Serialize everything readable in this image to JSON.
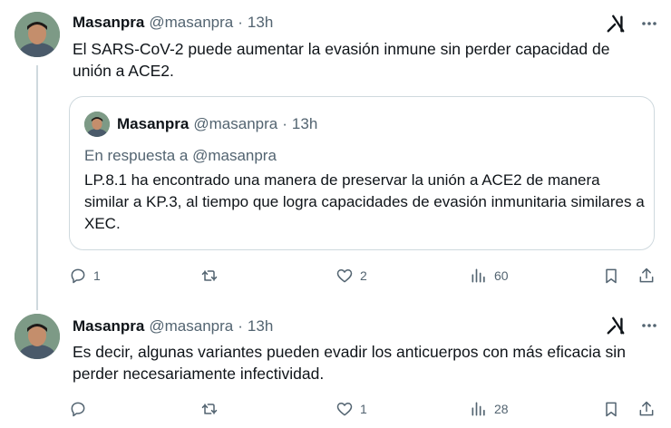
{
  "tweets": [
    {
      "author": {
        "name": "Masanpra",
        "handle": "@masanpra"
      },
      "time": "13h",
      "separator": "·",
      "text": "El SARS-CoV-2 puede aumentar la evasión inmune sin perder capacidad de unión a ACE2.",
      "quoted": {
        "author": {
          "name": "Masanpra",
          "handle": "@masanpra"
        },
        "time": "13h",
        "separator": "·",
        "reply_to": "En respuesta a @masanpra",
        "text": "LP.8.1 ha encontrado una manera de preservar la unión a ACE2 de manera similar a KP.3, al tiempo que logra capacidades de evasión inmunitaria similares a XEC."
      },
      "actions": {
        "replies": "1",
        "retweets": "",
        "likes": "2",
        "views": "60"
      }
    },
    {
      "author": {
        "name": "Masanpra",
        "handle": "@masanpra"
      },
      "time": "13h",
      "separator": "·",
      "text": "Es decir, algunas variantes pueden evadir los anticuerpos con más eficacia sin perder necesariamente infectividad.",
      "actions": {
        "replies": "",
        "retweets": "",
        "likes": "1",
        "views": "28"
      }
    }
  ],
  "icons": [
    "grok-icon",
    "more-icon",
    "reply-icon",
    "retweet-icon",
    "like-icon",
    "views-icon",
    "bookmark-icon",
    "share-icon"
  ],
  "colors": {
    "text": "#0f1419",
    "secondary": "#536471",
    "border": "#cfd9de"
  }
}
